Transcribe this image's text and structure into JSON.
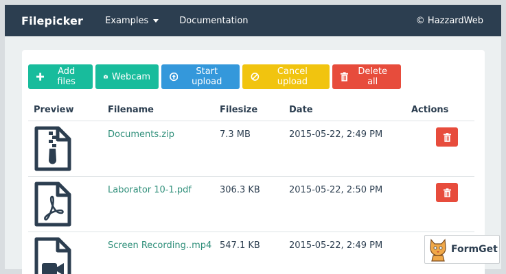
{
  "navbar": {
    "brand": "Filepicker",
    "items": [
      {
        "label": "Examples",
        "has_dropdown": true
      },
      {
        "label": "Documentation",
        "has_dropdown": false
      }
    ],
    "right": "© HazzardWeb"
  },
  "toolbar": {
    "add_files": "Add files",
    "webcam": "Webcam",
    "start_upload": "Start upload",
    "cancel_upload": "Cancel upload",
    "delete_all": "Delete all"
  },
  "table": {
    "headers": {
      "preview": "Preview",
      "filename": "Filename",
      "filesize": "Filesize",
      "date": "Date",
      "actions": "Actions"
    },
    "rows": [
      {
        "icon": "zip-file-icon",
        "filename": "Documents.zip",
        "filesize": "7.3 MB",
        "date": "2015-05-22, 2:49 PM"
      },
      {
        "icon": "pdf-file-icon",
        "filename": "Laborator 10-1.pdf",
        "filesize": "306.3 KB",
        "date": "2015-05-22, 2:50 PM"
      },
      {
        "icon": "video-file-icon",
        "filename": "Screen Recording..mp4",
        "filesize": "547.1 KB",
        "date": "2015-05-22, 2:49 PM"
      }
    ]
  },
  "watermark": {
    "label": "FormGet"
  },
  "colors": {
    "navbar": "#2c3e50",
    "success": "#18bc9c",
    "primary": "#3498db",
    "warning": "#f1c40f",
    "danger": "#e74c3c",
    "link": "#2f8f7a"
  }
}
